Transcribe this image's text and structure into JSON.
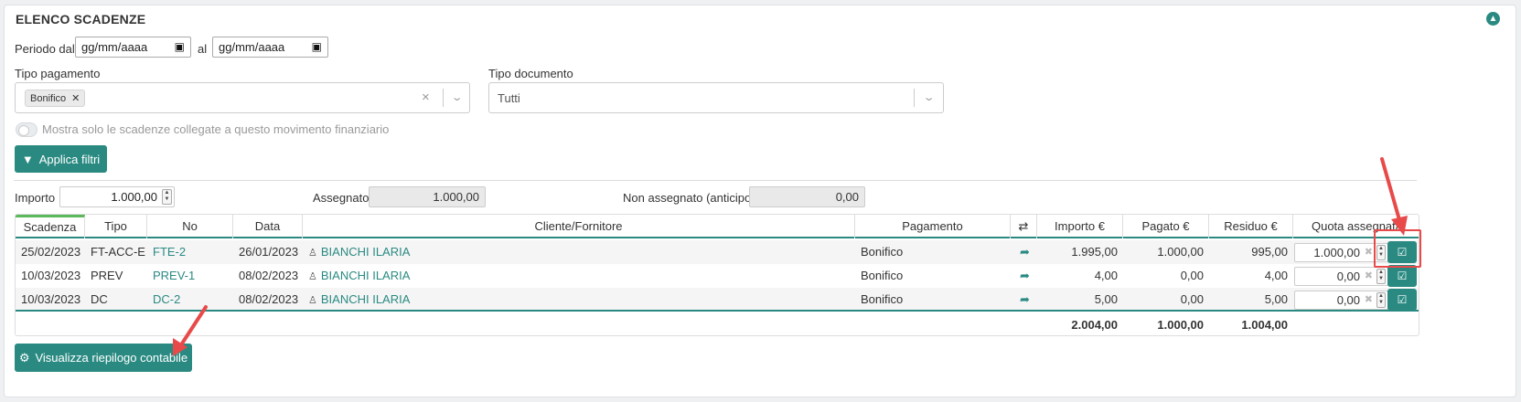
{
  "title": "ELENCO SCADENZE",
  "filters": {
    "period_from_label": "Periodo dal",
    "period_from_placeholder": "gg/mm/aaaa",
    "period_to_label": "al",
    "period_to_placeholder": "gg/mm/aaaa",
    "payment_type_label": "Tipo pagamento",
    "payment_type_tags": [
      "Bonifico"
    ],
    "document_type_label": "Tipo documento",
    "document_type_value": "Tutti",
    "toggle_label": "Mostra solo le scadenze collegate a questo movimento finanziario",
    "apply_button": "Applica filtri"
  },
  "amounts": {
    "importo_label": "Importo",
    "importo_value": "1.000,00",
    "assegnato_label": "Assegnato",
    "assegnato_value": "1.000,00",
    "non_assegnato_label": "Non assegnato (anticipo)",
    "non_assegnato_value": "0,00"
  },
  "table": {
    "headers": [
      "Scadenza",
      "Tipo",
      "No",
      "Data",
      "Cliente/Fornitore",
      "Pagamento",
      "⇄",
      "Importo €",
      "Pagato €",
      "Residuo €",
      "Quota assegnata"
    ],
    "rows": [
      {
        "scadenza": "25/02/2023",
        "tipo": "FT-ACC-E",
        "no": "FTE-2",
        "data": "26/01/2023",
        "cliente": "BIANCHI ILARIA",
        "pagamento": "Bonifico",
        "importo": "1.995,00",
        "pagato": "1.000,00",
        "residuo": "995,00",
        "quota": "1.000,00"
      },
      {
        "scadenza": "10/03/2023",
        "tipo": "PREV",
        "no": "PREV-1",
        "data": "08/02/2023",
        "cliente": "BIANCHI ILARIA",
        "pagamento": "Bonifico",
        "importo": "4,00",
        "pagato": "0,00",
        "residuo": "4,00",
        "quota": "0,00"
      },
      {
        "scadenza": "10/03/2023",
        "tipo": "DC",
        "no": "DC-2",
        "data": "08/02/2023",
        "cliente": "BIANCHI ILARIA",
        "pagamento": "Bonifico",
        "importo": "5,00",
        "pagato": "0,00",
        "residuo": "5,00",
        "quota": "0,00"
      }
    ],
    "totals": {
      "importo": "2.004,00",
      "pagato": "1.000,00",
      "residuo": "1.004,00"
    }
  },
  "summary_button": "Visualizza riepilogo contabile",
  "colors": {
    "accent": "#2a8a82",
    "annotation": "#e84a4a"
  }
}
